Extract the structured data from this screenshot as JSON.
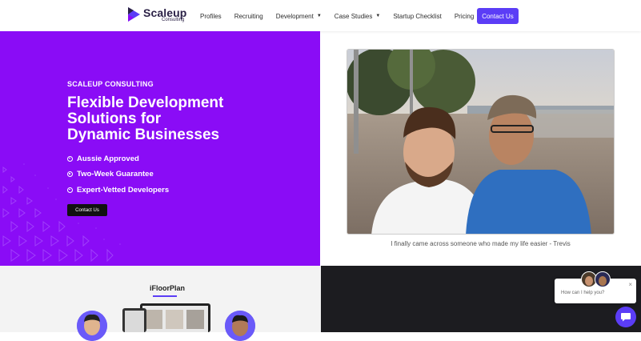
{
  "brand": {
    "name": "Scaleup",
    "sub": "Consulting"
  },
  "nav": {
    "items": [
      {
        "label": "Profiles"
      },
      {
        "label": "Recruiting"
      },
      {
        "label": "Development",
        "dropdown": true
      },
      {
        "label": "Case Studies",
        "dropdown": true
      },
      {
        "label": "Startup Checklist"
      },
      {
        "label": "Pricing"
      }
    ],
    "cta": "Contact Us"
  },
  "hero": {
    "eyebrow": "SCALEUP CONSULTING",
    "headline_lines": [
      "Flexible Development",
      "Solutions for",
      "Dynamic Businesses"
    ],
    "bullets": [
      "Aussie Approved",
      "Two-Week Guarantee",
      "Expert-Vetted Developers"
    ],
    "cta": "Contact Us",
    "color": "#8a0cf6"
  },
  "testimonial": {
    "caption": "I finally came across someone who made my life easier - Trevis"
  },
  "section": {
    "title": "iFloorPlan"
  },
  "chat": {
    "prompt": "How can I help you?",
    "close": "×"
  },
  "colors": {
    "accent": "#5b3df6",
    "hero": "#8a0cf6",
    "dark": "#1c1c20"
  }
}
